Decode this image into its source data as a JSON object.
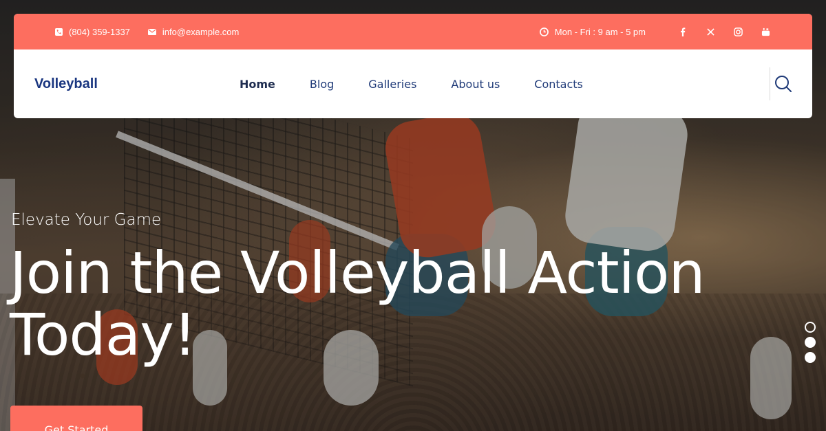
{
  "topbar": {
    "phone": "(804) 359-1337",
    "email": "info@example.com",
    "hours": "Mon - Fri : 9 am - 5 pm",
    "socials": [
      "facebook-icon",
      "x-icon",
      "instagram-icon",
      "youtube-icon"
    ],
    "background_color": "#fd6e5f"
  },
  "navbar": {
    "logo": "Volleyball",
    "menu": [
      {
        "label": "Home",
        "active": true
      },
      {
        "label": "Blog",
        "active": false
      },
      {
        "label": "Galleries",
        "active": false
      },
      {
        "label": "About us",
        "active": false
      },
      {
        "label": "Contacts",
        "active": false
      }
    ],
    "search_icon": "search-icon"
  },
  "hero": {
    "eyebrow": "Elevate Your Game",
    "title": "Join the Volleyball Action Today!",
    "cta_label": "Get Started",
    "accent_color": "#fd6e5f",
    "slider": {
      "total": 3,
      "active": 1
    }
  }
}
